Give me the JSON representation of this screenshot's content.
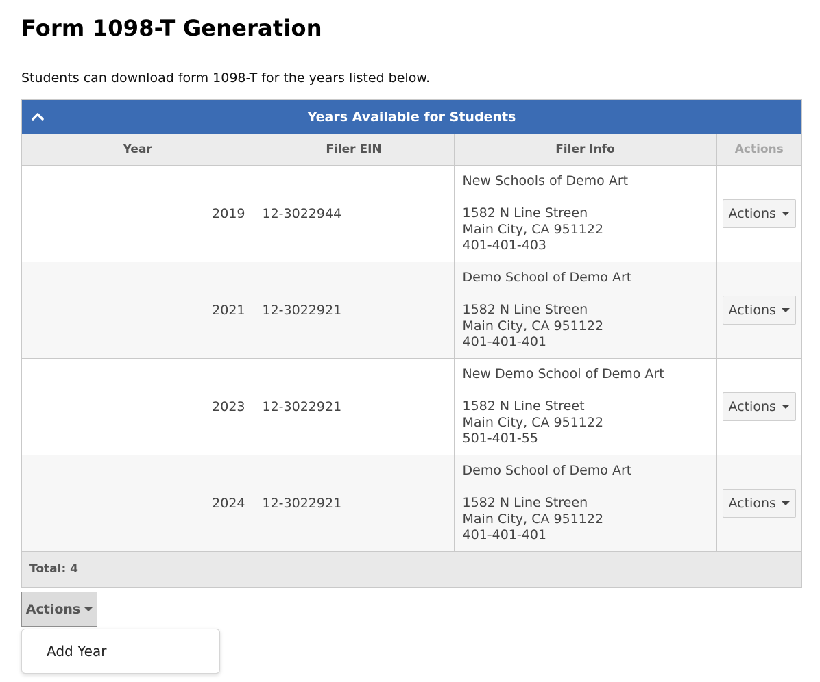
{
  "page": {
    "title": "Form 1098-T Generation",
    "intro": "Students can download form 1098-T for the years listed below."
  },
  "panel": {
    "title": "Years Available for Students",
    "columns": [
      "Year",
      "Filer EIN",
      "Filer Info",
      "Actions"
    ],
    "rows": [
      {
        "year": "2019",
        "ein": "12-3022944",
        "name": "New Schools of Demo Art",
        "street": "1582 N Line Streen",
        "city": "Main City, CA 951122",
        "phone": "401-401-403",
        "action_label": "Actions"
      },
      {
        "year": "2021",
        "ein": "12-3022921",
        "name": "Demo School of Demo Art",
        "street": "1582 N Line Streen",
        "city": "Main City, CA 951122",
        "phone": "401-401-401",
        "action_label": "Actions"
      },
      {
        "year": "2023",
        "ein": "12-3022921",
        "name": "New Demo School of Demo Art",
        "street": "1582 N Line Street",
        "city": "Main City, CA 951122",
        "phone": "501-401-55",
        "action_label": "Actions"
      },
      {
        "year": "2024",
        "ein": "12-3022921",
        "name": "Demo School of Demo Art",
        "street": "1582 N Line Streen",
        "city": "Main City, CA 951122",
        "phone": "401-401-401",
        "action_label": "Actions"
      }
    ],
    "footer": "Total: 4"
  },
  "main_actions": {
    "label": "Actions",
    "menu": [
      "Add Year"
    ]
  },
  "icons": {
    "collapse": "chevron-up-icon",
    "dropdown": "caret-down-icon"
  },
  "colors": {
    "header_bg": "#3b6cb4",
    "header_text": "#ffffff"
  }
}
